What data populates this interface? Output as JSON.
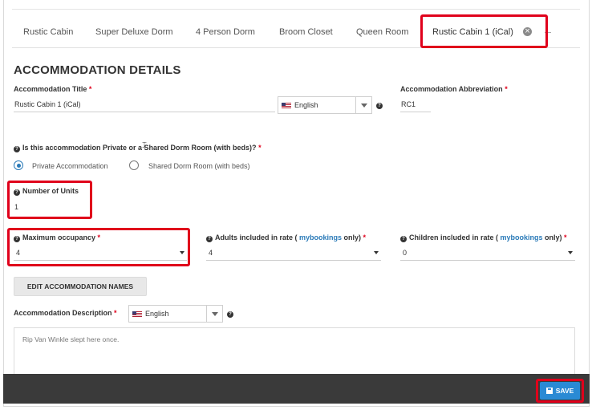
{
  "tabs": [
    {
      "label": "Rustic Cabin"
    },
    {
      "label": "Super Deluxe Dorm"
    },
    {
      "label": "4 Person Dorm"
    },
    {
      "label": "Broom Closet"
    },
    {
      "label": "Queen Room"
    },
    {
      "label": "Rustic Cabin 1 (iCal)",
      "active": true
    }
  ],
  "section_title": "ACCOMMODATION DETAILS",
  "fields": {
    "title": {
      "label": "Accommodation Title",
      "value": "Rustic Cabin 1 (iCal)",
      "language": "English"
    },
    "abbreviation": {
      "label": "Accommodation Abbreviation",
      "value": "RC1"
    },
    "type_question": "Is this accommodation Private or a Shared Dorm Room (with beds)?",
    "type_options": [
      {
        "label": "Private Accommodation",
        "checked": true
      },
      {
        "label": "Shared Dorm Room (with beds)",
        "checked": false
      }
    ],
    "units": {
      "label": "Number of Units",
      "value": "1"
    },
    "max_occupancy": {
      "label": "Maximum occupancy",
      "value": "4"
    },
    "adults": {
      "label_pre": "Adults included in rate ( ",
      "link": "mybookings",
      "label_post": " only)",
      "value": "4"
    },
    "children": {
      "label_pre": "Children included in rate ( ",
      "link": "mybookings",
      "label_post": " only)",
      "value": "0"
    },
    "edit_names_button": "EDIT ACCOMMODATION NAMES",
    "description": {
      "label": "Accommodation Description",
      "language": "English",
      "value": "Rip Van Winkle slept here once."
    }
  },
  "required_mark": "*",
  "help_glyph": "?",
  "close_glyph": "×",
  "save_button": "SAVE",
  "colors": {
    "highlight": "#e0001b",
    "accent": "#2a7ab8",
    "save": "#2a8ad4",
    "footer": "#3a3a3a"
  },
  "icons": [
    "close-icon",
    "plus-icon",
    "help-icon",
    "flag-us-icon",
    "caret-down-icon",
    "save-icon"
  ]
}
